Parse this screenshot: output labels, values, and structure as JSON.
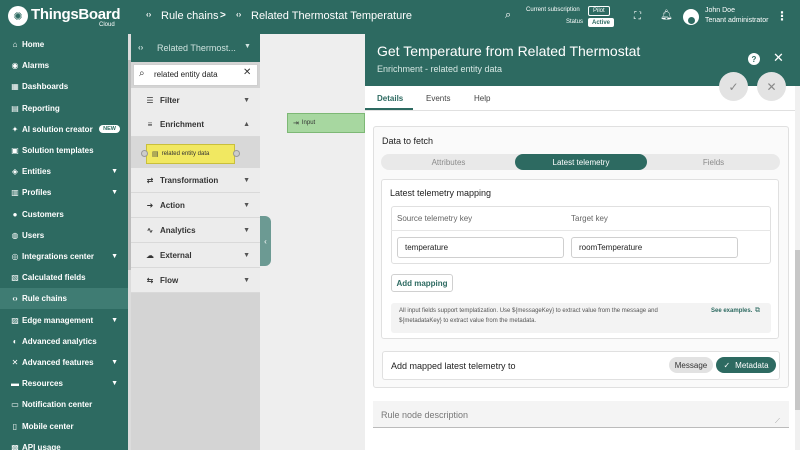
{
  "app": {
    "name": "ThingsBoard",
    "subtitle": "Cloud"
  },
  "breadcrumb": {
    "root": "Rule chains",
    "separator": ">",
    "current": "Related Thermostat Temperature"
  },
  "topbar": {
    "subscription_label": "Current subscription",
    "subscription_value": "Pilot",
    "status_label": "Status",
    "status_value": "Active",
    "user_name": "John Doe",
    "user_role": "Tenant administrator"
  },
  "sidebar": {
    "items": [
      {
        "label": "Home",
        "icon": "home-icon",
        "glyph": "⌂"
      },
      {
        "label": "Alarms",
        "icon": "bell-icon",
        "glyph": "◉"
      },
      {
        "label": "Dashboards",
        "icon": "dashboard-icon",
        "glyph": "▦"
      },
      {
        "label": "Reporting",
        "icon": "report-icon",
        "glyph": "▤"
      },
      {
        "label": "AI solution creator",
        "icon": "sparkle-icon",
        "glyph": "✦",
        "badge": "NEW"
      },
      {
        "label": "Solution templates",
        "icon": "template-icon",
        "glyph": "▣"
      },
      {
        "label": "Entities",
        "icon": "entities-icon",
        "glyph": "◈",
        "chevron": true
      },
      {
        "label": "Profiles",
        "icon": "profiles-icon",
        "glyph": "▥",
        "chevron": true
      },
      {
        "label": "Customers",
        "icon": "customers-icon",
        "glyph": "●"
      },
      {
        "label": "Users",
        "icon": "users-icon",
        "glyph": "◍"
      },
      {
        "label": "Integrations center",
        "icon": "integrations-icon",
        "glyph": "◎",
        "chevron": true
      },
      {
        "label": "Calculated fields",
        "icon": "calc-icon",
        "glyph": "▧"
      },
      {
        "label": "Rule chains",
        "icon": "rule-chains-icon",
        "glyph": "‹›",
        "active": true
      },
      {
        "label": "Edge management",
        "icon": "edge-icon",
        "glyph": "▨",
        "chevron": true
      },
      {
        "label": "Advanced analytics",
        "icon": "analytics-icon",
        "glyph": "◐"
      },
      {
        "label": "Advanced features",
        "icon": "features-icon",
        "glyph": "✕",
        "chevron": true
      },
      {
        "label": "Resources",
        "icon": "folder-icon",
        "glyph": "▬",
        "chevron": true
      },
      {
        "label": "Notification center",
        "icon": "notification-icon",
        "glyph": "▭"
      },
      {
        "label": "Mobile center",
        "icon": "mobile-icon",
        "glyph": "▯"
      },
      {
        "label": "API usage",
        "icon": "api-icon",
        "glyph": "▩"
      }
    ]
  },
  "palette": {
    "header_title": "Related Thermost...",
    "search_value": "related entity data",
    "categories": [
      {
        "label": "Filter",
        "icon": "filter-icon",
        "glyph": "☰",
        "state": "collapsed"
      },
      {
        "label": "Enrichment",
        "icon": "enrichment-icon",
        "glyph": "≡",
        "state": "expanded"
      },
      {
        "label": "Transformation",
        "icon": "transformation-icon",
        "glyph": "⇄",
        "state": "collapsed"
      },
      {
        "label": "Action",
        "icon": "action-icon",
        "glyph": "➜",
        "state": "collapsed"
      },
      {
        "label": "Analytics",
        "icon": "analytics-icon",
        "glyph": "∿",
        "state": "collapsed"
      },
      {
        "label": "External",
        "icon": "cloud-icon",
        "glyph": "☁",
        "state": "collapsed"
      },
      {
        "label": "Flow",
        "icon": "flow-icon",
        "glyph": "⇆",
        "state": "collapsed"
      }
    ],
    "enrichment_node": "related entity data"
  },
  "canvas": {
    "input_node": "Input"
  },
  "panel": {
    "title": "Get Temperature from Related Thermostat",
    "subtitle": "Enrichment - related entity data",
    "tabs": [
      {
        "label": "Details",
        "active": true
      },
      {
        "label": "Events",
        "active": false
      },
      {
        "label": "Help",
        "active": false
      }
    ],
    "data_to_fetch": {
      "title": "Data to fetch",
      "options": [
        {
          "label": "Attributes",
          "selected": false
        },
        {
          "label": "Latest telemetry",
          "selected": true
        },
        {
          "label": "Fields",
          "selected": false
        }
      ]
    },
    "mapping": {
      "title": "Latest telemetry mapping",
      "source_header": "Source telemetry key",
      "target_header": "Target key",
      "rows": [
        {
          "source": "temperature",
          "target": "roomTemperature"
        }
      ],
      "add_button": "Add mapping"
    },
    "hint": {
      "text": "All input fields support templatization. Use ${messageKey} to extract value from the message and ${metadataKey} to extract value from the metadata.",
      "link": "See examples."
    },
    "add_mapped": {
      "label": "Add mapped latest telemetry to",
      "options": [
        {
          "label": "Message",
          "selected": false
        },
        {
          "label": "Metadata",
          "selected": true
        }
      ]
    },
    "description_placeholder": "Rule node description"
  },
  "colors": {
    "primary": "#2d6a61",
    "primary_dark": "#305680",
    "node_yellow": "#f1e861",
    "node_green": "#a7d7a0"
  }
}
